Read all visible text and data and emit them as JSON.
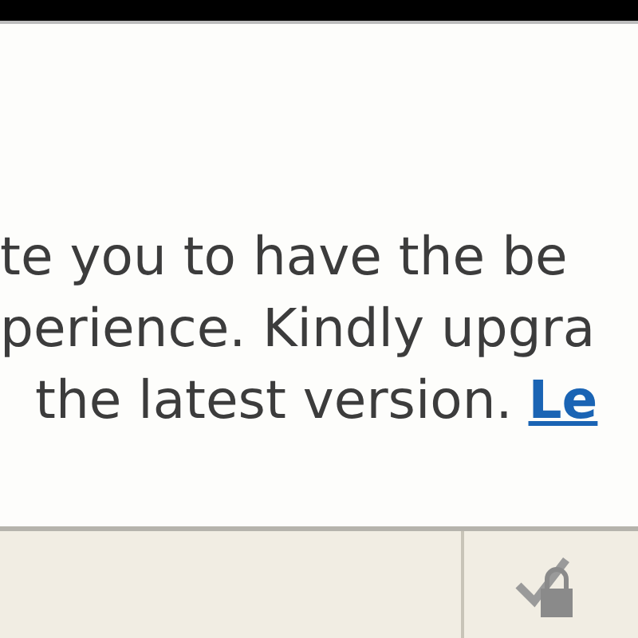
{
  "message": {
    "lines": [
      "te you to have the be",
      "perience. Kindly upgra",
      "the latest version."
    ],
    "link": "Le"
  }
}
